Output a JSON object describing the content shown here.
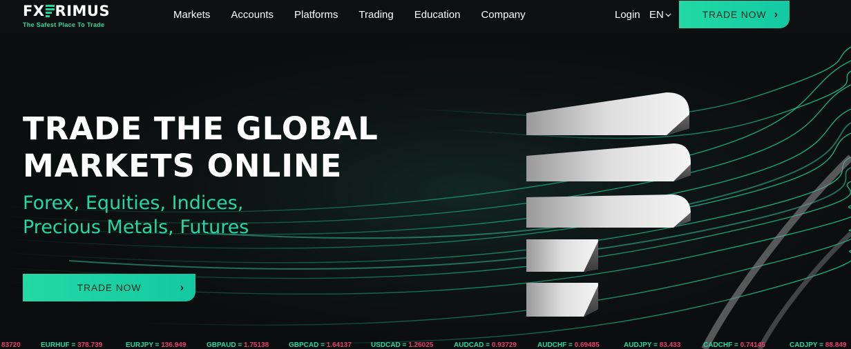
{
  "brand": {
    "logo_left": "FX",
    "logo_right": "RIMUS",
    "tagline": "The Safest Place To Trade",
    "accent": "#22d9a5",
    "negative": "#e83e6b"
  },
  "nav": {
    "items": [
      "Markets",
      "Accounts",
      "Platforms",
      "Trading",
      "Education",
      "Company"
    ],
    "login": "Login",
    "language": "EN",
    "trade_now": "TRADE NOW"
  },
  "hero": {
    "title_line1": "TRADE THE GLOBAL",
    "title_line2": "MARKETS ONLINE",
    "subtitle_line1": "Forex, Equities, Indices,",
    "subtitle_line2": "Precious Metals, Futures",
    "cta": "TRADE NOW"
  },
  "ticker": [
    {
      "pair": "",
      "value": "83720"
    },
    {
      "pair": "EURHUF = ",
      "value": "378.739"
    },
    {
      "pair": "EURJPY = ",
      "value": "136.949"
    },
    {
      "pair": "GBPAUD = ",
      "value": "1.75138"
    },
    {
      "pair": "GBPCAD = ",
      "value": "1.64137"
    },
    {
      "pair": "USDCAD = ",
      "value": "1.26025"
    },
    {
      "pair": "AUDCAD = ",
      "value": "0.93729"
    },
    {
      "pair": "AUDCHF = ",
      "value": "0.69485"
    },
    {
      "pair": "AUDJPY = ",
      "value": "83.433"
    },
    {
      "pair": "CADCHF = ",
      "value": "0.74145"
    },
    {
      "pair": "CADJPY = ",
      "value": "88.849"
    }
  ]
}
